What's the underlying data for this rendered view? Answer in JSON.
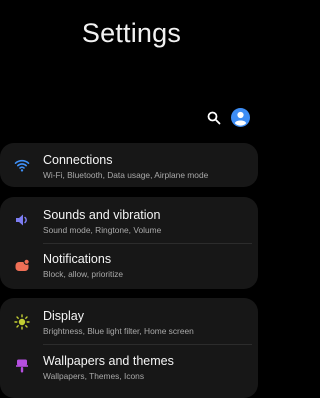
{
  "header": {
    "title": "Settings"
  },
  "toolbar": {
    "search_icon": "search-icon",
    "account_icon": "account-icon"
  },
  "colors": {
    "accent": "#3d8df5",
    "connections_icon": "#3f8ff5",
    "sounds_icon": "#7d7df2",
    "notifications_icon": "#ef6f56",
    "display_icon": "#c4d033",
    "wallpapers_icon": "#b54fe0"
  },
  "items": [
    {
      "label": "Connections",
      "subtitle": "Wi-Fi, Bluetooth, Data usage, Airplane mode",
      "icon": "wifi-icon"
    },
    {
      "label": "Sounds and vibration",
      "subtitle": "Sound mode, Ringtone, Volume",
      "icon": "volume-icon"
    },
    {
      "label": "Notifications",
      "subtitle": "Block, allow, prioritize",
      "icon": "notifications-icon"
    },
    {
      "label": "Display",
      "subtitle": "Brightness, Blue light filter, Home screen",
      "icon": "brightness-icon"
    },
    {
      "label": "Wallpapers and themes",
      "subtitle": "Wallpapers, Themes, Icons",
      "icon": "brush-icon"
    }
  ]
}
